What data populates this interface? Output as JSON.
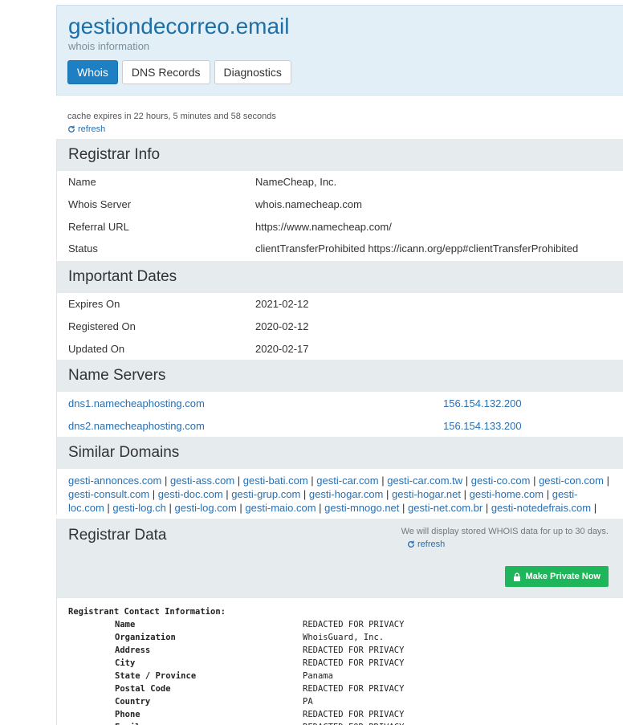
{
  "header": {
    "domain": "gestiondecorreo.email",
    "subtitle": "whois information",
    "tabs": [
      "Whois",
      "DNS Records",
      "Diagnostics"
    ]
  },
  "cache": {
    "text": "cache expires in 22 hours, 5 minutes and 58 seconds",
    "refresh_label": "refresh"
  },
  "registrar_info": {
    "title": "Registrar Info",
    "rows": [
      {
        "k": "Name",
        "v": "NameCheap, Inc."
      },
      {
        "k": "Whois Server",
        "v": "whois.namecheap.com"
      },
      {
        "k": "Referral URL",
        "v": "https://www.namecheap.com/"
      },
      {
        "k": "Status",
        "v": "clientTransferProhibited https://icann.org/epp#clientTransferProhibited"
      }
    ]
  },
  "important_dates": {
    "title": "Important Dates",
    "rows": [
      {
        "k": "Expires On",
        "v": "2021-02-12"
      },
      {
        "k": "Registered On",
        "v": "2020-02-12"
      },
      {
        "k": "Updated On",
        "v": "2020-02-17"
      }
    ]
  },
  "name_servers": {
    "title": "Name Servers",
    "rows": [
      {
        "host": "dns1.namecheaphosting.com",
        "ip": "156.154.132.200"
      },
      {
        "host": "dns2.namecheaphosting.com",
        "ip": "156.154.133.200"
      }
    ]
  },
  "similar_domains": {
    "title": "Similar Domains",
    "domains": [
      "gesti-annonces.com",
      "gesti-ass.com",
      "gesti-bati.com",
      "gesti-car.com",
      "gesti-car.com.tw",
      "gesti-co.com",
      "gesti-con.com",
      "gesti-consult.com",
      "gesti-doc.com",
      "gesti-grup.com",
      "gesti-hogar.com",
      "gesti-hogar.net",
      "gesti-home.com",
      "gesti-loc.com",
      "gesti-log.ch",
      "gesti-log.com",
      "gesti-maio.com",
      "gesti-mnogo.net",
      "gesti-net.com.br",
      "gesti-notedefrais.com"
    ]
  },
  "registrar_data": {
    "title": "Registrar Data",
    "note": "We will display stored WHOIS data for up to 30 days.",
    "refresh_label": "refresh",
    "button_label": "Make Private Now"
  },
  "raw": {
    "heading": "Registrant Contact Information:",
    "rows": [
      {
        "k": "Name",
        "v": "REDACTED FOR PRIVACY"
      },
      {
        "k": "Organization",
        "v": "WhoisGuard, Inc."
      },
      {
        "k": "Address",
        "v": "REDACTED FOR PRIVACY"
      },
      {
        "k": "City",
        "v": "REDACTED FOR PRIVACY"
      },
      {
        "k": "State / Province",
        "v": "Panama"
      },
      {
        "k": "Postal Code",
        "v": "REDACTED FOR PRIVACY"
      },
      {
        "k": "Country",
        "v": "PA"
      },
      {
        "k": "Phone",
        "v": "REDACTED FOR PRIVACY"
      },
      {
        "k": "Email",
        "v": "REDACTED FOR PRIVACY"
      }
    ]
  }
}
